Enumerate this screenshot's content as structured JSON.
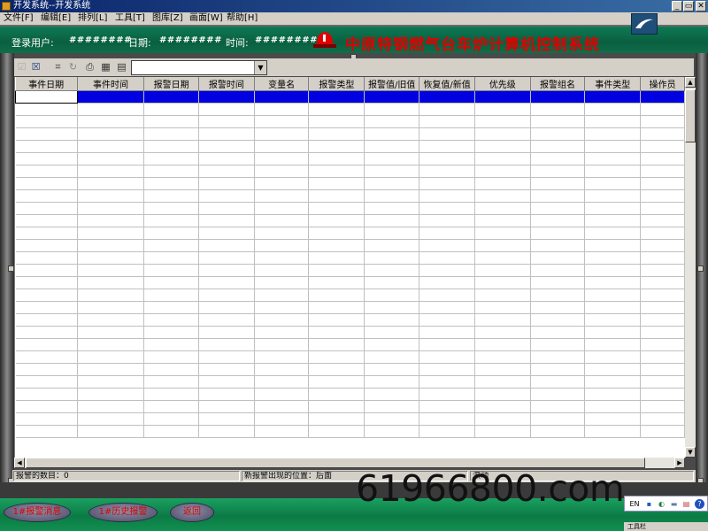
{
  "window": {
    "title": "开发系统--开发系统",
    "controls": [
      "_",
      "▭",
      "✕"
    ]
  },
  "menu": [
    "文件[F]",
    "编辑[E]",
    "排列[L]",
    "工具[T]",
    "图库[Z]",
    "画面[W]",
    "帮助[H]"
  ],
  "header": {
    "user_label": "登录用户:",
    "user_value": "########",
    "date_label": "日期:",
    "date_value": "########",
    "time_label": "时间:",
    "time_value": "########",
    "system_title": "中原特钢燃气台车炉计算机控制系统"
  },
  "toolbar": {
    "icons": [
      "check-icon",
      "checkbox-icon",
      "select-icon",
      "refresh-icon",
      "print-icon",
      "export-icon",
      "copy-icon"
    ],
    "combo_value": ""
  },
  "grid": {
    "columns": [
      "事件日期",
      "事件时间",
      "报警日期",
      "报警时间",
      "变量名",
      "报警类型",
      "报警值/旧值",
      "恢复值/新值",
      "优先级",
      "报警组名",
      "事件类型",
      "操作员"
    ],
    "empty_rows": 28
  },
  "status": {
    "count_label": "报警的数目：0",
    "position_label": "新报警出现的位置：后面",
    "scroll_label": "滚动"
  },
  "buttons": {
    "alarm_messages": "1#报警消息",
    "history_alarms": "1#历史报警",
    "back": "返回"
  },
  "watermark": "61966800.com",
  "tray": {
    "text": "EN",
    "bottom_text": "工具栏"
  },
  "colors": {
    "header_green": "#0a5f40",
    "title_red": "#e00000",
    "selection_blue": "#0000e0",
    "bottom_green": "#0c7a45"
  }
}
